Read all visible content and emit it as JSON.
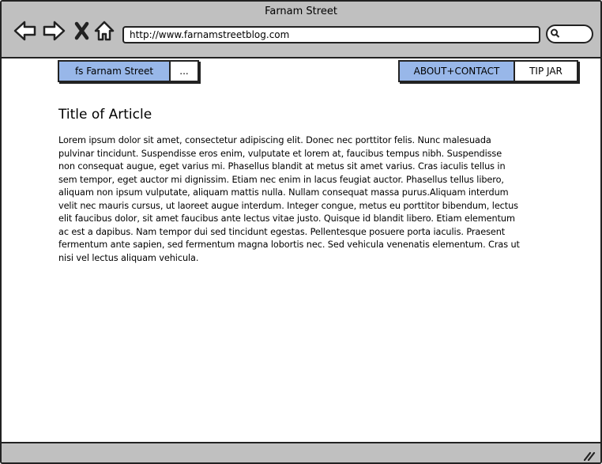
{
  "window": {
    "title": "Farnam Street",
    "url": "http://www.farnamstreetblog.com"
  },
  "nav": {
    "left": [
      {
        "label": "fs Farnam Street",
        "selected": true
      },
      {
        "label": "...",
        "selected": false
      }
    ],
    "right": [
      {
        "label": "ABOUT+CONTACT",
        "selected": true
      },
      {
        "label": "TIP JAR",
        "selected": false
      }
    ]
  },
  "article": {
    "title": "Title of Article",
    "body": "Lorem ipsum dolor sit amet, consectetur adipiscing elit. Donec nec porttitor felis. Nunc malesuada pulvinar tincidunt. Suspendisse eros enim, vulputate et lorem at, faucibus tempus nibh. Suspendisse non consequat augue, eget varius mi. Phasellus blandit at metus sit amet varius. Cras iaculis tellus in sem tempor, eget auctor mi dignissim. Etiam nec enim in lacus feugiat auctor. Phasellus tellus libero, aliquam non ipsum vulputate, aliquam mattis nulla. Nullam consequat massa purus.Aliquam interdum velit nec mauris cursus, ut laoreet augue interdum. Integer congue, metus eu porttitor bibendum, lectus elit faucibus dolor, sit amet faucibus ante lectus vitae justo. Quisque id blandit libero. Etiam elementum ac est a dapibus. Nam tempor dui sed tincidunt egestas. Pellentesque posuere porta iaculis. Praesent fermentum ante sapien, sed fermentum magna lobortis nec. Sed vehicula venenatis elementum. Cras ut nisi vel lectus aliquam vehicula."
  },
  "colors": {
    "chrome": "#c0c0c0",
    "selected": "#98b7e9",
    "outline": "#222222"
  },
  "icons": [
    "back-arrow-icon",
    "forward-arrow-icon",
    "close-x-icon",
    "home-icon",
    "search-icon",
    "resize-grip-icon"
  ]
}
